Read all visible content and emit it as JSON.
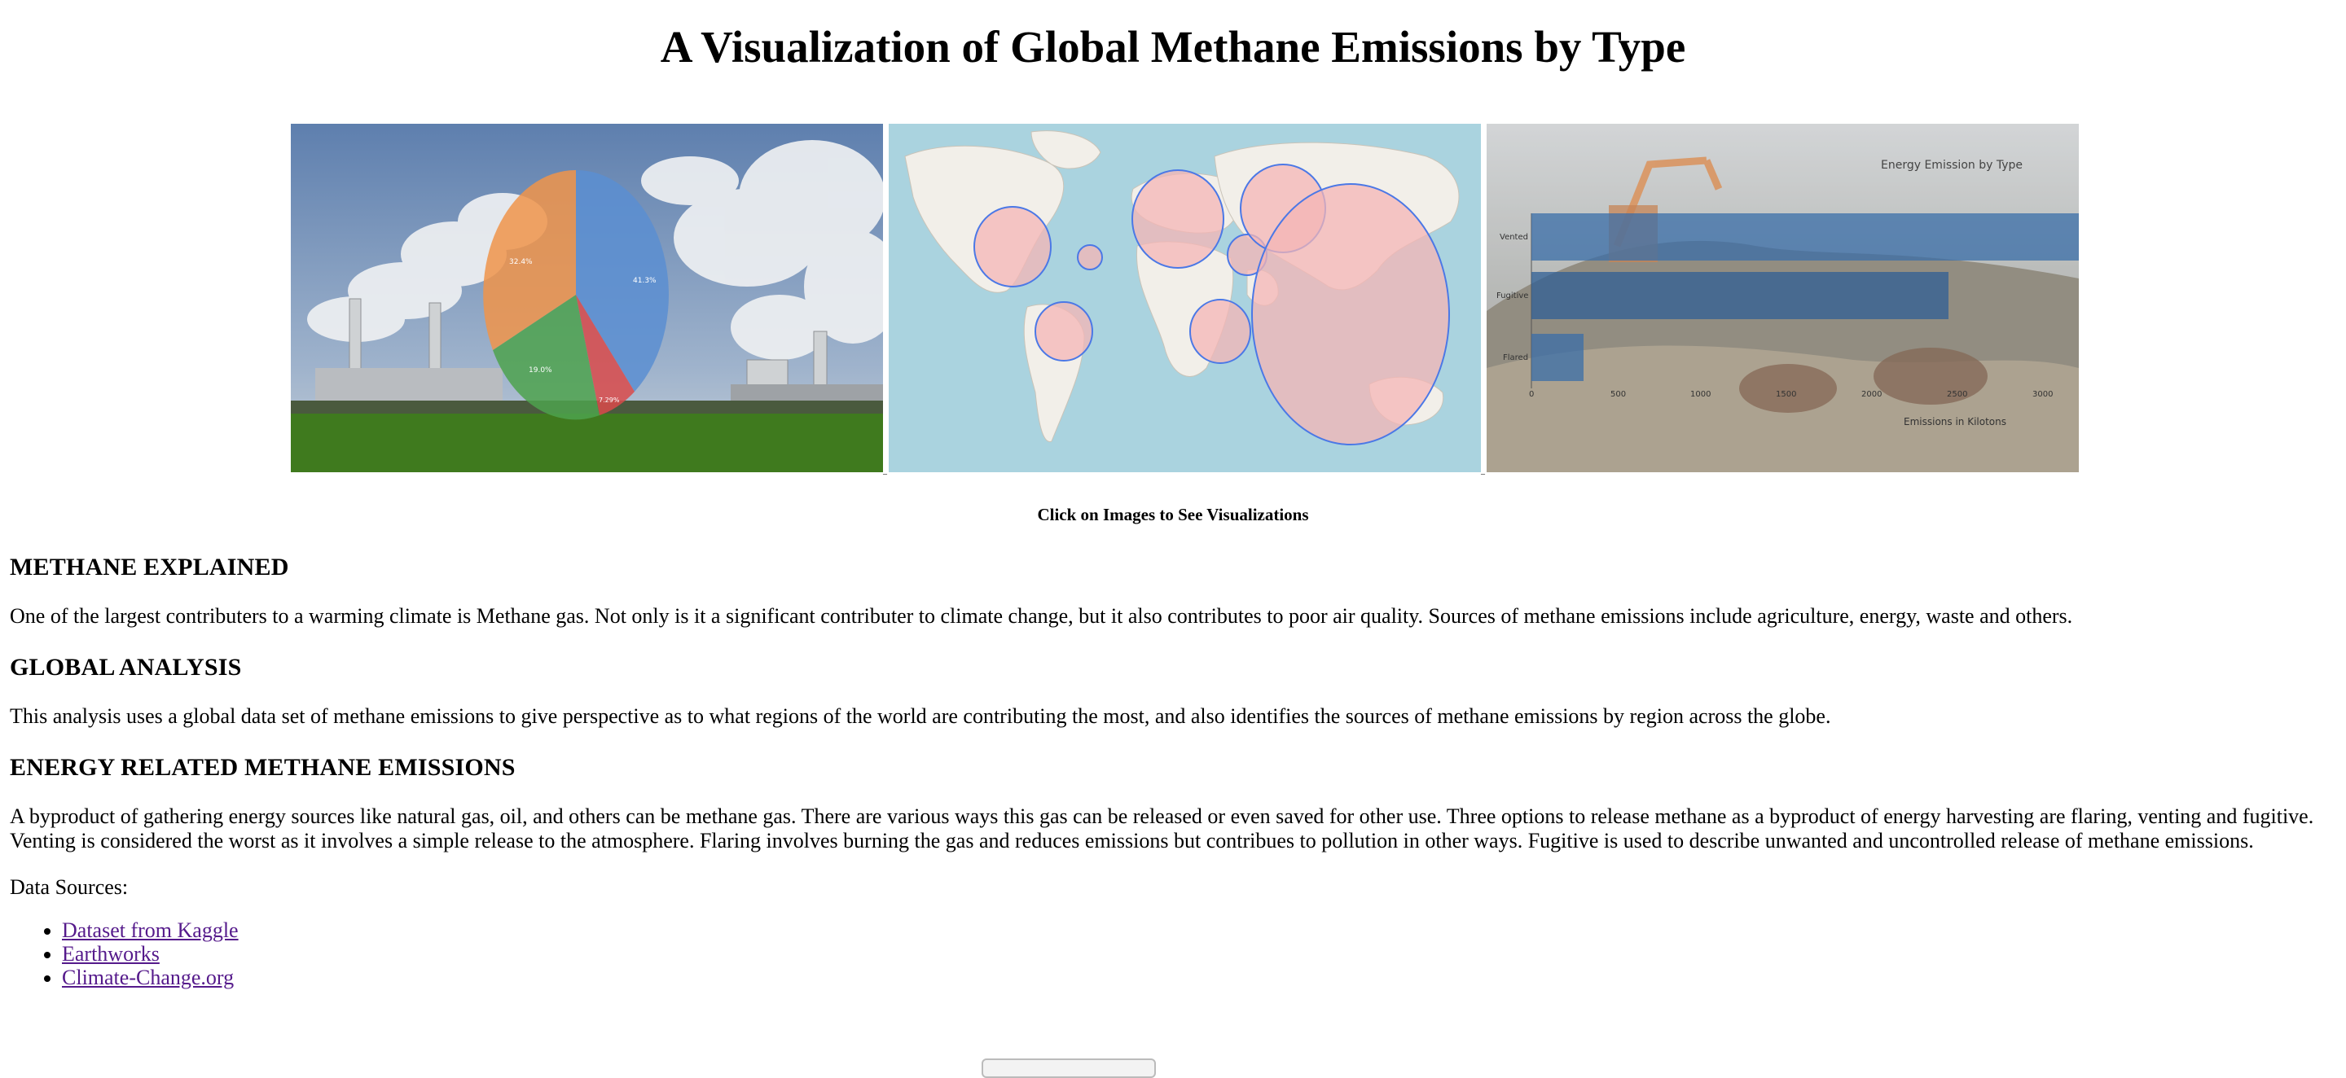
{
  "page": {
    "title": "A Visualization of Global Methane Emissions by Type"
  },
  "gallery": {
    "caption": "Click on Images to See Visualizations",
    "pie": {
      "labels": [
        "41.3%",
        "32.4%",
        "19.0%",
        "7.29%"
      ]
    },
    "bar": {
      "title": "Energy Emission by Type",
      "xlabel": "Emissions in Kilotons",
      "categories": [
        "Vented",
        "Fugitive",
        "Flared"
      ],
      "ticks": [
        "0",
        "500",
        "1000",
        "1500",
        "2000",
        "2500",
        "3000"
      ]
    }
  },
  "sections": [
    {
      "heading": "METHANE EXPLAINED",
      "body": "One of the largest contributers to a warming climate is Methane gas. Not only is it a significant contributer to climate change, but it also contributes to poor air quality. Sources of methane emissions include agriculture, energy, waste and others."
    },
    {
      "heading": "GLOBAL ANALYSIS",
      "body": "This analysis uses a global data set of methane emissions to give perspective as to what regions of the world are contributing the most, and also identifies the sources of methane emissions by region across the globe."
    },
    {
      "heading": "ENERGY RELATED METHANE EMISSIONS",
      "body": "A byproduct of gathering energy sources like natural gas, oil, and others can be methane gas. There are various ways this gas can be released or even saved for other use. Three options to release methane as a byproduct of energy harvesting are flaring, venting and fugitive. Venting is considered the worst as it involves a simple release to the atmosphere. Flaring involves burning the gas and reduces emissions but contribues to pollution in other ways. Fugitive is used to describe unwanted and uncontrolled release of methane emissions."
    }
  ],
  "sources": {
    "label": "Data Sources:",
    "links": [
      "Dataset from Kaggle",
      "Earthworks",
      "Climate-Change.org"
    ]
  },
  "colors": {
    "link_visited": "#551a8b",
    "sky": "#6f8fb8",
    "ocean": "#aad3df",
    "bubble": "#f4b5b5",
    "bubble_stroke": "#4b78e6"
  }
}
